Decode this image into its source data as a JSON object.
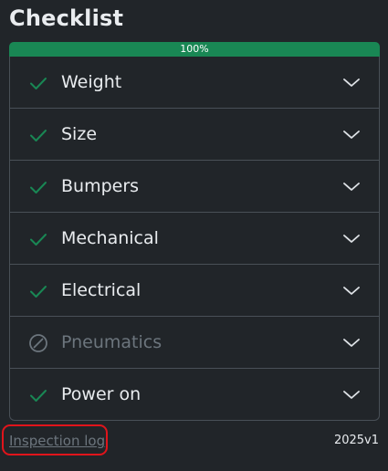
{
  "header": {
    "title": "Checklist"
  },
  "progress": {
    "value_percent": 100,
    "label": "100%",
    "color": "#198754"
  },
  "checklist": {
    "items": [
      {
        "label": "Weight",
        "status": "done",
        "icon": "check-icon"
      },
      {
        "label": "Size",
        "status": "done",
        "icon": "check-icon"
      },
      {
        "label": "Bumpers",
        "status": "done",
        "icon": "check-icon"
      },
      {
        "label": "Mechanical",
        "status": "done",
        "icon": "check-icon"
      },
      {
        "label": "Electrical",
        "status": "done",
        "icon": "check-icon"
      },
      {
        "label": "Pneumatics",
        "status": "not-applicable",
        "icon": "prohibited-icon"
      },
      {
        "label": "Power on",
        "status": "done",
        "icon": "check-icon"
      }
    ]
  },
  "footer": {
    "link_label": "Inspection log",
    "version": "2025v1"
  },
  "colors": {
    "background": "#212529",
    "check": "#198754",
    "disabled": "#6c757d",
    "highlight": "#e0141b"
  }
}
